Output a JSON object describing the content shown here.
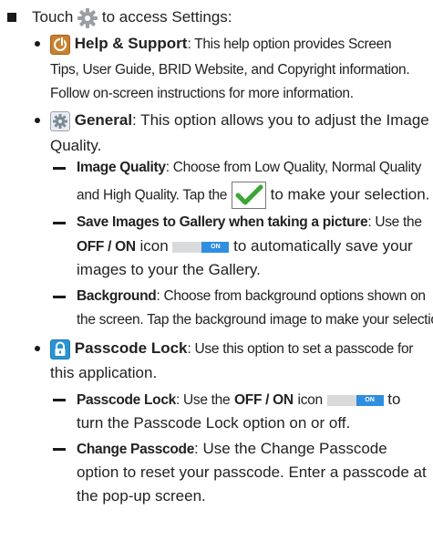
{
  "intro": {
    "before_icon": "Touch",
    "after_icon": "to access Settings:"
  },
  "help": {
    "title": "Help & Support",
    "line1": ": This help option provides Screen",
    "line2": "Tips, User Guide, BRID Website, and Copyright information.",
    "line3": "Follow on-screen instructions for more information."
  },
  "general": {
    "title": "General",
    "line1": ": This option allows you to adjust the Image",
    "line2": "Quality.",
    "image_quality": {
      "title": "Image Quality",
      "line1": ": Choose from Low Quality, Normal Quality",
      "line2_a": "and High Quality. Tap the",
      "line2_b": "to make your selection."
    },
    "save_images": {
      "title": "Save Images to Gallery when taking a picture",
      "line1_rest": ": Use the",
      "toggle_label": "OFF / ON",
      "line2_rest": "icon",
      "line2_b": "to automatically save your",
      "line3": "images to your the Gallery."
    },
    "background": {
      "title": "Background",
      "line1": ": Choose from background options shown on",
      "line2": "the screen. Tap the background image to make your selection."
    }
  },
  "passcode": {
    "title": "Passcode Lock",
    "line1": ": Use this option to set a passcode for",
    "line2": "this application.",
    "lock_item": {
      "title": "Passcode Lock",
      "line1_a": ": Use the",
      "toggle_label": "OFF / ON",
      "line1_b": "icon",
      "line1_c": "to",
      "line2": "turn the Passcode Lock option on or off."
    },
    "change_item": {
      "title": "Change Passcode",
      "line1": ": Use the Change Passcode",
      "line2": "option to reset your passcode. Enter a passcode at",
      "line3": "the pop-up screen."
    }
  },
  "toggle_text": "ON",
  "colors": {
    "text": "#222222",
    "help_icon": "#c9812f",
    "lock_icon": "#2a93d4",
    "toggle_on": "#2f8ee0",
    "check": "#3aa637"
  }
}
